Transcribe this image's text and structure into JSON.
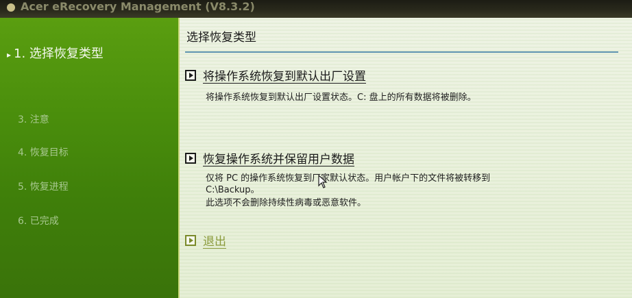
{
  "window": {
    "title": "Acer eRecovery Management (V8.3.2)"
  },
  "sidebar": {
    "active_marker": "▸",
    "items": [
      {
        "label": "1. 选择恢复类型"
      },
      {
        "label": "3. 注意"
      },
      {
        "label": "4. 恢复目标"
      },
      {
        "label": "5. 恢复进程"
      },
      {
        "label": "6. 已完成"
      }
    ]
  },
  "main": {
    "title": "选择恢复类型",
    "options": [
      {
        "label": "将操作系统恢复到默认出厂设置",
        "description": "将操作系统恢复到默认出厂设置状态。C: 盘上的所有数据将被删除。"
      },
      {
        "label": "恢复操作系统并保留用户数据",
        "description_lines": [
          "仅将 PC 的操作系统恢复到厂家默认状态。用户帐户下的文件将被转移到",
          "C:\\Backup。",
          "此选项不会删除持续性病毒或恶意软件。"
        ]
      }
    ],
    "exit_label": "退出"
  }
}
